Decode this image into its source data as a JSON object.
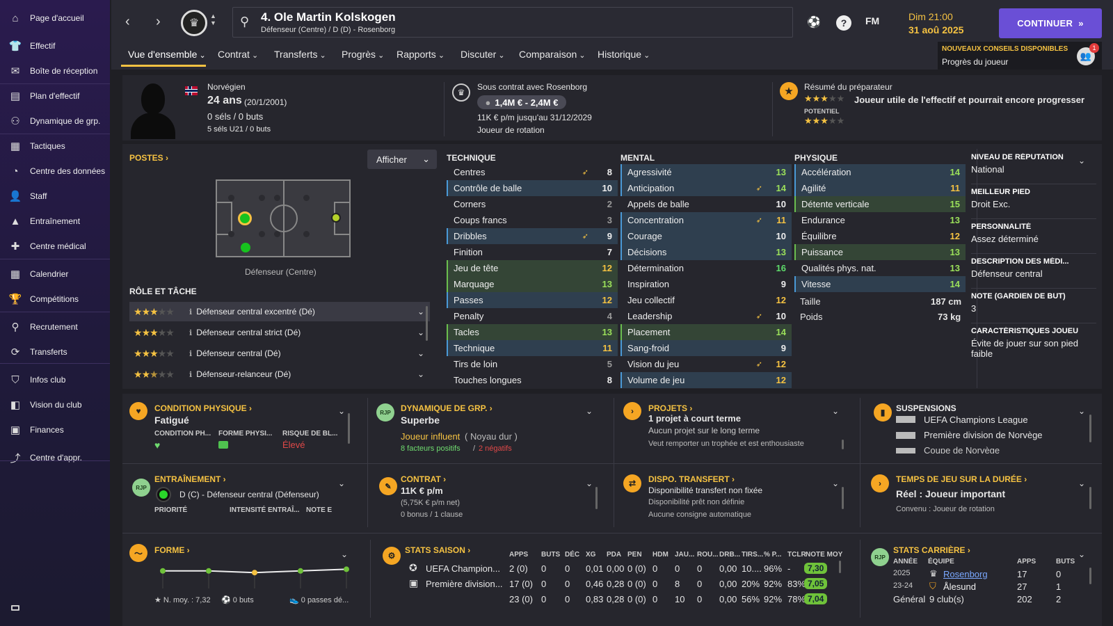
{
  "sidebar": {
    "items": [
      {
        "label": "Page d'accueil",
        "icon": "home-icon"
      },
      {
        "label": "Effectif",
        "icon": "shirt-icon"
      },
      {
        "label": "Boîte de réception",
        "icon": "inbox-icon"
      },
      {
        "label": "Plan d'effectif",
        "icon": "clipboard-icon"
      },
      {
        "label": "Dynamique de grp.",
        "icon": "people-icon"
      },
      {
        "label": "Tactiques",
        "icon": "tactics-icon"
      },
      {
        "label": "Centre des données",
        "icon": "data-icon"
      },
      {
        "label": "Staff",
        "icon": "staff-icon"
      },
      {
        "label": "Entraînement",
        "icon": "training-icon"
      },
      {
        "label": "Centre médical",
        "icon": "medical-icon"
      },
      {
        "label": "Calendrier",
        "icon": "calendar-icon"
      },
      {
        "label": "Compétitions",
        "icon": "trophy-icon"
      },
      {
        "label": "Recrutement",
        "icon": "search-icon"
      },
      {
        "label": "Transferts",
        "icon": "transfer-icon"
      },
      {
        "label": "Infos club",
        "icon": "shield-icon"
      },
      {
        "label": "Vision du club",
        "icon": "vision-icon"
      },
      {
        "label": "Finances",
        "icon": "finance-icon"
      },
      {
        "label": "Centre d'appr.",
        "icon": "academy-icon"
      }
    ]
  },
  "header": {
    "player_title": "4. Ole Martin Kolskogen",
    "player_sub": "Défenseur (Centre) / D (D) - Rosenborg",
    "fm": "FM",
    "date": "Dim 21:00",
    "date2": "31 aoû 2025",
    "continue": "CONTINUER",
    "advice_title": "NOUVEAUX CONSEILS DISPONIBLES",
    "advice_sub": "Progrès du joueur",
    "advice_count": "1"
  },
  "tabs": [
    "Vue d'ensemble",
    "Contrat",
    "Transferts",
    "Progrès",
    "Rapports",
    "Discuter",
    "Comparaison",
    "Historique"
  ],
  "profile": {
    "nationality": "Norvégien",
    "age": "24 ans",
    "dob": "(20/1/2001)",
    "caps": "0 séls / 0 buts",
    "u21": "5 séls U21 / 0 buts",
    "contract_with": "Sous contrat avec Rosenborg",
    "value": "1,4M € - 2,4M €",
    "wage": "11K € p/m jusqu'au 31/12/2029",
    "status": "Joueur de rotation",
    "coach_title": "Résumé du préparateur",
    "coach_text": "Joueur utile de l'effectif et pourrait encore progresser",
    "potential": "POTENTIEL",
    "ability_stars": 3,
    "potential_stars": 3
  },
  "positions": {
    "title": "POSTES",
    "show": "Afficher",
    "label": "Défenseur (Centre)",
    "role_title": "RÔLE ET TÂCHE",
    "roles": [
      {
        "stars": "3",
        "name": "Défenseur central excentré (Dé)"
      },
      {
        "stars": "3",
        "name": "Défenseur central strict (Dé)"
      },
      {
        "stars": "3",
        "name": "Défenseur central (Dé)"
      },
      {
        "stars": "2.5",
        "name": "Défenseur-relanceur (Dé)"
      }
    ]
  },
  "technique": {
    "title": "TECHNIQUE",
    "rows": [
      [
        "Centres",
        "8"
      ],
      [
        "Contrôle de balle",
        "10"
      ],
      [
        "Corners",
        "2"
      ],
      [
        "Coups francs",
        "3"
      ],
      [
        "Dribbles",
        "9"
      ],
      [
        "Finition",
        "7"
      ],
      [
        "Jeu de tête",
        "12"
      ],
      [
        "Marquage",
        "13"
      ],
      [
        "Passes",
        "12"
      ],
      [
        "Penalty",
        "4"
      ],
      [
        "Tacles",
        "13"
      ],
      [
        "Technique",
        "11"
      ],
      [
        "Tirs de loin",
        "5"
      ],
      [
        "Touches longues",
        "8"
      ]
    ]
  },
  "mental": {
    "title": "MENTAL",
    "rows": [
      [
        "Agressivité",
        "13"
      ],
      [
        "Anticipation",
        "14"
      ],
      [
        "Appels de balle",
        "10"
      ],
      [
        "Concentration",
        "11"
      ],
      [
        "Courage",
        "10"
      ],
      [
        "Décisions",
        "13"
      ],
      [
        "Détermination",
        "16"
      ],
      [
        "Inspiration",
        "9"
      ],
      [
        "Jeu collectif",
        "12"
      ],
      [
        "Leadership",
        "10"
      ],
      [
        "Placement",
        "14"
      ],
      [
        "Sang-froid",
        "9"
      ],
      [
        "Vision du jeu",
        "12"
      ],
      [
        "Volume de jeu",
        "12"
      ]
    ]
  },
  "physique": {
    "title": "PHYSIQUE",
    "rows": [
      [
        "Accélération",
        "14"
      ],
      [
        "Agilité",
        "11"
      ],
      [
        "Détente verticale",
        "15"
      ],
      [
        "Endurance",
        "13"
      ],
      [
        "Équilibre",
        "12"
      ],
      [
        "Puissance",
        "13"
      ],
      [
        "Qualités phys. nat.",
        "13"
      ],
      [
        "Vitesse",
        "14"
      ]
    ],
    "height_label": "Taille",
    "height": "187 cm",
    "weight_label": "Poids",
    "weight": "73 kg"
  },
  "side_info": [
    {
      "k": "NIVEAU DE RÉPUTATION",
      "v": "National"
    },
    {
      "k": "MEILLEUR PIED",
      "v": "Droit Exc."
    },
    {
      "k": "PERSONNALITÉ",
      "v": "Assez déterminé"
    },
    {
      "k": "DESCRIPTION DES MÉDI...",
      "v": "Défenseur central"
    },
    {
      "k": "NOTE (GARDIEN DE BUT)",
      "v": "3"
    },
    {
      "k": "CARACTÉRISTIQUES JOUEU",
      "v": "Évite de jouer sur son pied faible"
    }
  ],
  "cards": {
    "condition": {
      "title": "CONDITION PHYSIQUE",
      "value": "Fatigué",
      "c1": "CONDITION PH...",
      "c2": "FORME PHYSI...",
      "c3": "RISQUE DE BL...",
      "risk": "Élevé"
    },
    "dynamics": {
      "title": "DYNAMIQUE DE GRP.",
      "value": "Superbe",
      "influence": "Joueur influent",
      "group": "( Noyau dur )",
      "pos": "8 facteurs positifs",
      "sep": "/",
      "neg": "2 négatifs",
      "icon": "RJP"
    },
    "projects": {
      "title": "PROJETS",
      "value": "1 projet à court terme",
      "l2": "Aucun projet sur le long terme",
      "l3": "Veut remporter un trophée et est enthousiaste"
    },
    "suspensions": {
      "title": "SUSPENSIONS",
      "l1": "UEFA Champions League",
      "l2": "Première division de Norvège",
      "l3": "Coupe de Norvège"
    },
    "training": {
      "title": "ENTRAÎNEMENT",
      "value": "D (C) - Défenseur central (Défenseur)",
      "c1": "PRIORITÉ",
      "c2": "INTENSITÉ ENTRAÎ...",
      "c3": "NOTE E",
      "icon": "RJP"
    },
    "contract": {
      "title": "CONTRAT",
      "value": "11K € p/m",
      "l2": "(5,75K € p/m net)",
      "l3": "0 bonus / 1 clause"
    },
    "transfer": {
      "title": "DISPO. TRANSFERT",
      "value": "Disponibilité transfert non fixée",
      "l2": "Disponibilité prêt non définie",
      "l3": "Aucune consigne automatique"
    },
    "playtime": {
      "title": "TEMPS DE JEU SUR LA DURÉE",
      "value": "Réel : Joueur important",
      "l2": "Convenu : Joueur de rotation"
    }
  },
  "form": {
    "title": "FORME",
    "avg": "N. moy. : 7,32",
    "goals": "0 buts",
    "assists": "0 passes dé...",
    "points": [
      0.55,
      0.55,
      0.45,
      0.55,
      0.65
    ]
  },
  "season": {
    "title": "STATS SAISON",
    "headers": [
      "APPS",
      "BUTS",
      "DÉC",
      "XG",
      "PDA",
      "PEN",
      "HDM",
      "JAU...",
      "ROU...",
      "DRB...",
      "TIRS...",
      "% P...",
      "TCLR",
      "NOTE MOY"
    ],
    "rows": [
      {
        "comp": "UEFA Champion...",
        "vals": [
          "2 (0)",
          "0",
          "0",
          "0,01",
          "0,00",
          "0 (0)",
          "0",
          "0",
          "0",
          "0,00",
          "10....",
          "96%",
          "-"
        ],
        "note": "7,30"
      },
      {
        "comp": "Première division...",
        "vals": [
          "17 (0)",
          "0",
          "0",
          "0,46",
          "0,28",
          "0 (0)",
          "0",
          "8",
          "0",
          "0,00",
          "20%",
          "92%",
          "83%"
        ],
        "note": "7,05"
      },
      {
        "comp": "",
        "vals": [
          "23 (0)",
          "0",
          "0",
          "0,83",
          "0,28",
          "0 (0)",
          "0",
          "10",
          "0",
          "0,00",
          "56%",
          "92%",
          "78%"
        ],
        "note": "7,04"
      }
    ]
  },
  "career": {
    "title": "STATS CARRIÈRE",
    "h_year": "ANNÉE",
    "h_team": "ÉQUIPE",
    "h_apps": "APPS",
    "h_goals": "BUTS",
    "icon": "RJP",
    "rows": [
      {
        "year": "2025",
        "team": "Rosenborg",
        "apps": "17",
        "goals": "0"
      },
      {
        "year": "23-24",
        "team": "Ålesund",
        "apps": "27",
        "goals": "1"
      }
    ],
    "total_label": "Général",
    "total_clubs": "9 club(s)",
    "total_apps": "202",
    "total_goals": "2"
  },
  "colors": {
    "accent": "#f5c242",
    "continue": "#6a4fd6",
    "sidebar": "#2a1b4e"
  }
}
